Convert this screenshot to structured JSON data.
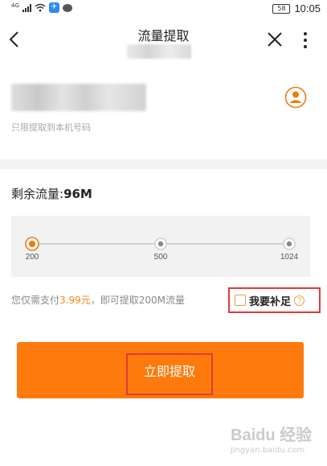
{
  "status_bar": {
    "network": "4G",
    "app_glyph": "✈",
    "battery": "58",
    "time": "10:05"
  },
  "nav": {
    "title": "流量提取"
  },
  "phone": {
    "hint": "只限提取到本机号码"
  },
  "remaining": {
    "label": "剩余流量:",
    "value": "96M"
  },
  "slider": {
    "options": [
      "200",
      "500",
      "1024"
    ],
    "selected": "200",
    "accent": "#f07a10"
  },
  "payment": {
    "prefix": "您仅需支付",
    "price": "3.99元",
    "suffix": "，即可提取200M流量"
  },
  "topup": {
    "label": "我要补足",
    "help": "?",
    "checked": false
  },
  "action": {
    "label": "立即提取",
    "color": "#ff7a0c"
  },
  "watermark": {
    "main": "Baidu 经验",
    "sub": "jingyan.baidu.com"
  },
  "icons": [
    "back-arrow-icon",
    "close-icon",
    "more-vertical-icon",
    "contact-person-icon",
    "help-question-icon",
    "signal-icon",
    "wifi-icon",
    "message-icon",
    "battery-icon"
  ]
}
